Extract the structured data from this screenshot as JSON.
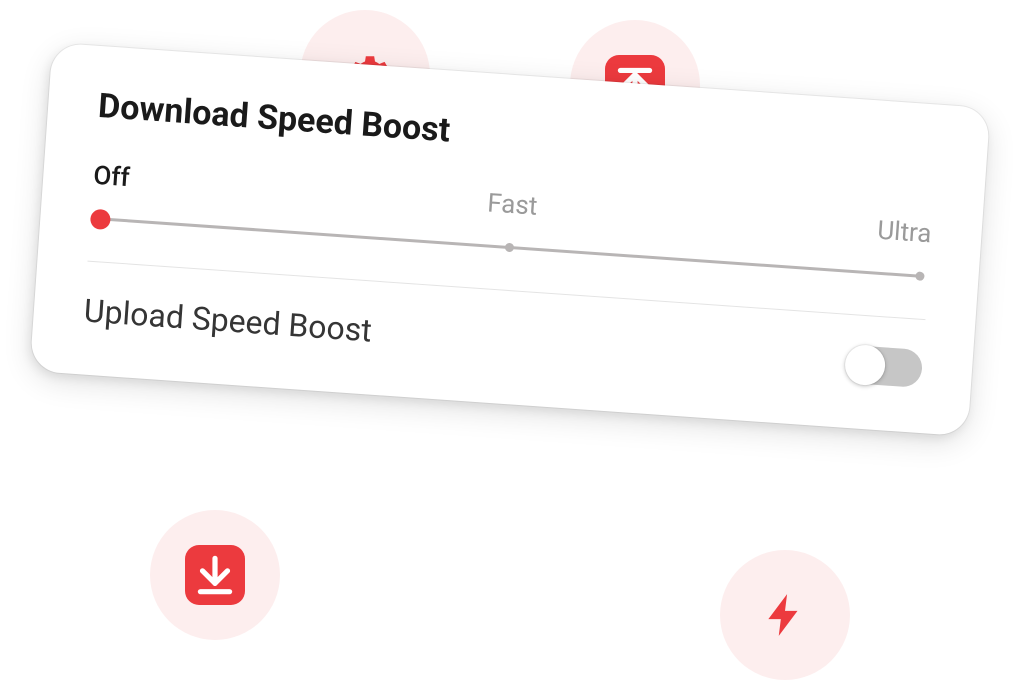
{
  "colors": {
    "accent": "#ec3a3e",
    "circleBg": "#fdeeee",
    "sliderTrack": "#b8b5b5",
    "toggleOff": "#c6c6c6"
  },
  "backgroundIcons": {
    "gear": "gear-icon",
    "upload": "upload-icon",
    "download": "download-icon",
    "bolt": "bolt-icon"
  },
  "card": {
    "downloadBoost": {
      "title": "Download Speed Boost",
      "slider": {
        "options": [
          "Off",
          "Fast",
          "Ultra"
        ],
        "selectedIndex": 0
      }
    },
    "uploadBoost": {
      "title": "Upload Speed Boost",
      "toggle": {
        "on": false
      }
    }
  }
}
